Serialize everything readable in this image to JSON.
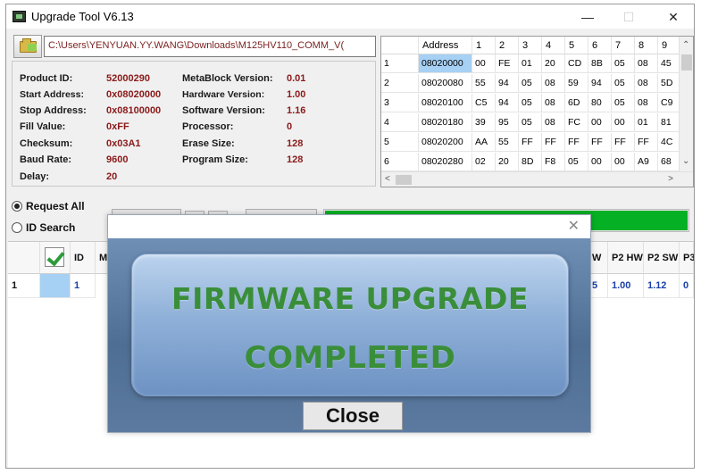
{
  "window": {
    "title": "Upgrade Tool V6.13",
    "minimize": "—",
    "maximize": "☐",
    "close": "✕"
  },
  "path": "C:\\Users\\YENYUAN.YY.WANG\\Downloads\\M125HV110_COMM_V(",
  "info": {
    "product_id_label": "Product ID:",
    "product_id": "52000290",
    "start_label": "Start Address:",
    "start": "0x08020000",
    "stop_label": "Stop Address:",
    "stop": "0x08100000",
    "fill_label": "Fill Value:",
    "fill": "0xFF",
    "checksum_label": "Checksum:",
    "checksum": "0x03A1",
    "baud_label": "Baud Rate:",
    "baud": "9600",
    "delay_label": "Delay:",
    "delay": "20",
    "meta_label": "MetaBlock Version:",
    "meta": "0.01",
    "hw_label": "Hardware Version:",
    "hw": "1.00",
    "sw_label": "Software Version:",
    "sw": "1.16",
    "proc_label": "Processor:",
    "proc": "0",
    "erase_label": "Erase Size:",
    "erase": "128",
    "prog_label": "Program Size:",
    "prog": "128"
  },
  "hex_grid": {
    "headers": [
      "Address",
      "1",
      "2",
      "3",
      "4",
      "5",
      "6",
      "7",
      "8",
      "9"
    ],
    "rows": [
      {
        "n": "1",
        "addr": "08020000",
        "bytes": [
          "00",
          "FE",
          "01",
          "20",
          "CD",
          "8B",
          "05",
          "08",
          "45"
        ]
      },
      {
        "n": "2",
        "addr": "08020080",
        "bytes": [
          "55",
          "94",
          "05",
          "08",
          "59",
          "94",
          "05",
          "08",
          "5D"
        ]
      },
      {
        "n": "3",
        "addr": "08020100",
        "bytes": [
          "C5",
          "94",
          "05",
          "08",
          "6D",
          "80",
          "05",
          "08",
          "C9"
        ]
      },
      {
        "n": "4",
        "addr": "08020180",
        "bytes": [
          "39",
          "95",
          "05",
          "08",
          "FC",
          "00",
          "00",
          "01",
          "81"
        ]
      },
      {
        "n": "5",
        "addr": "08020200",
        "bytes": [
          "AA",
          "55",
          "FF",
          "FF",
          "FF",
          "FF",
          "FF",
          "FF",
          "4C"
        ]
      },
      {
        "n": "6",
        "addr": "08020280",
        "bytes": [
          "02",
          "20",
          "8D",
          "F8",
          "05",
          "00",
          "00",
          "A9",
          "68"
        ]
      }
    ]
  },
  "options": {
    "request_all": "Request All",
    "id_search": "ID Search"
  },
  "progress": {
    "value": 1.0,
    "color": "#06b025"
  },
  "table": {
    "headers": {
      "id": "ID",
      "mc": "MC",
      "w": "W",
      "p2hw": "P2 HW",
      "p2sw": "P2 SW",
      "p3": "P3"
    },
    "row": {
      "n": "1",
      "id": "1",
      "w": "5",
      "p2hw": "1.00",
      "p2sw": "1.12",
      "p3": "0"
    }
  },
  "dialog": {
    "close_x": "✕",
    "line1": "FIRMWARE UPGRADE",
    "line2": "COMPLETED",
    "button": "Close"
  }
}
